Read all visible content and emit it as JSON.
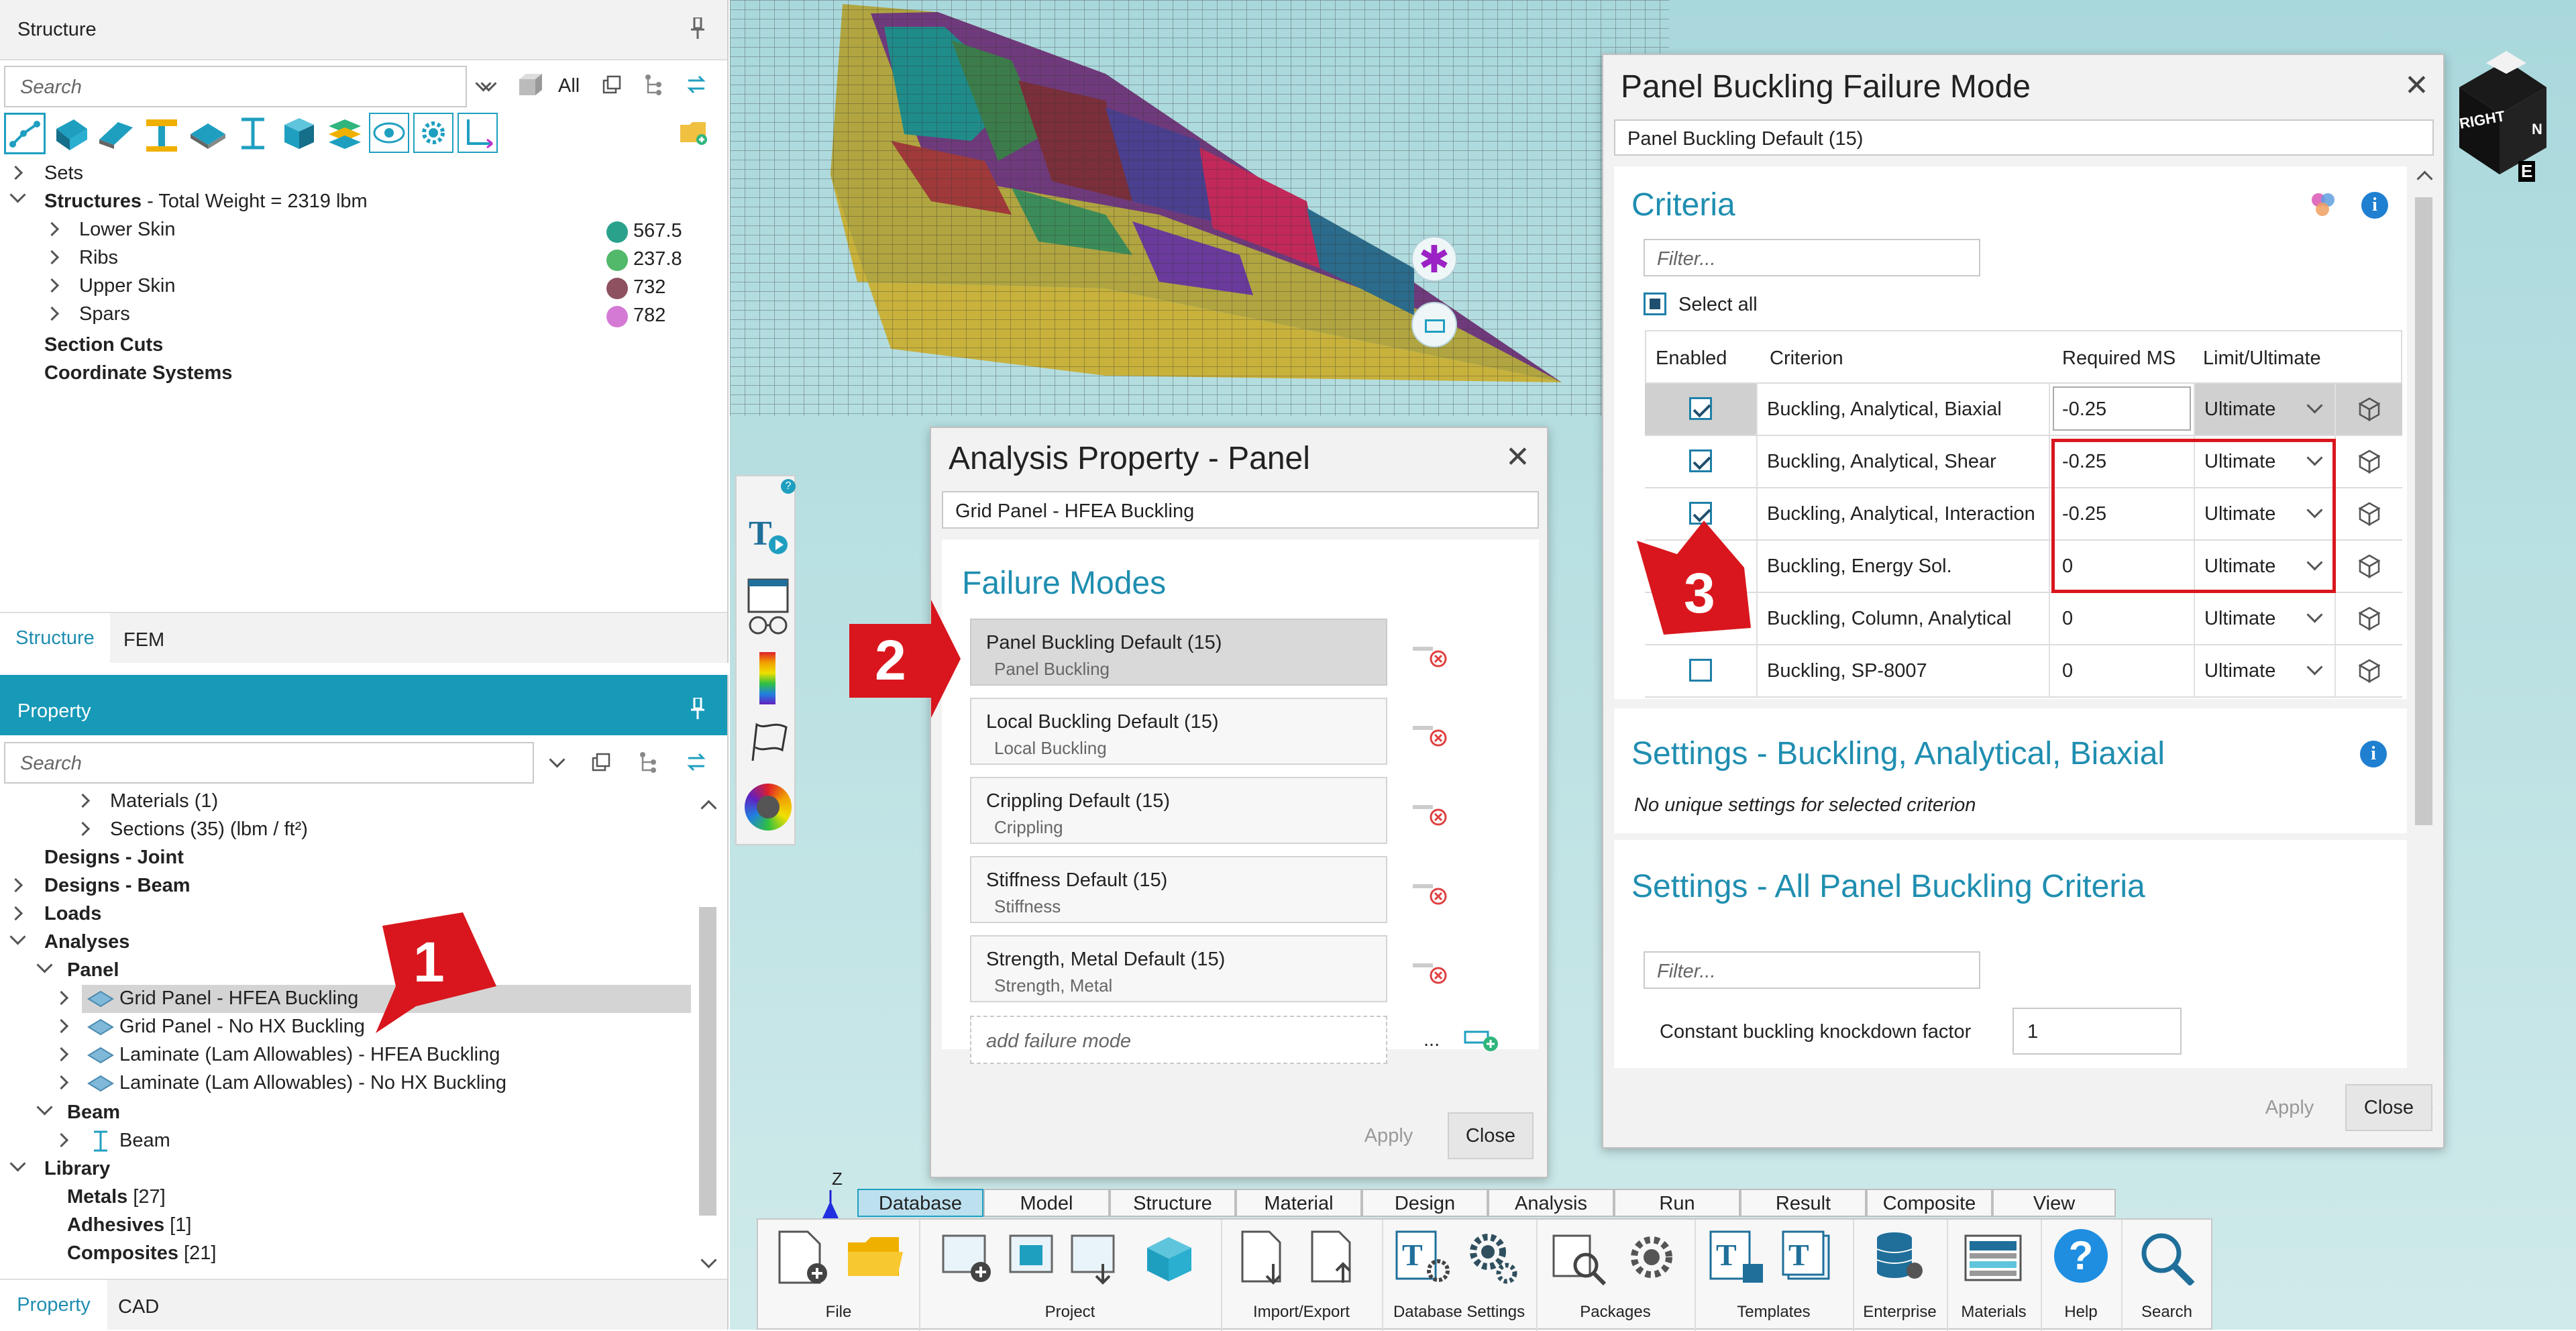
{
  "structure_panel": {
    "title": "Structure",
    "search_placeholder": "Search",
    "filter_label": "All",
    "tree": {
      "sets": "Sets",
      "structures_label": "Structures",
      "structures_weight": " - Total Weight = 2319 lbm",
      "children": [
        {
          "label": "Lower Skin",
          "value": "567.5",
          "color": "#2aa28b"
        },
        {
          "label": "Ribs",
          "value": "237.8",
          "color": "#52b86a"
        },
        {
          "label": "Upper Skin",
          "value": "732",
          "color": "#8e5160"
        },
        {
          "label": "Spars",
          "value": "782",
          "color": "#d47ad5"
        }
      ],
      "section_cuts": "Section Cuts",
      "coordinate_systems": "Coordinate Systems"
    },
    "tabs": [
      "Structure",
      "FEM"
    ]
  },
  "property_panel": {
    "title": "Property",
    "search_placeholder": "Search",
    "tree": {
      "materials": "Materials (1)",
      "sections": "Sections (35) (lbm / ft²)",
      "designs_joint": "Designs - Joint",
      "designs_beam": "Designs - Beam",
      "loads": "Loads",
      "analyses": "Analyses",
      "panel": "Panel",
      "panel_items": [
        "Grid Panel - HFEA Buckling",
        "Grid Panel - No HX Buckling",
        "Laminate (Lam Allowables) - HFEA Buckling",
        "Laminate (Lam Allowables) - No HX Buckling"
      ],
      "beam": "Beam",
      "beam_item": "Beam",
      "library": "Library",
      "library_items": [
        {
          "label": "Metals",
          "count": " [27]"
        },
        {
          "label": "Adhesives",
          "count": " [1]"
        },
        {
          "label": "Composites",
          "count": " [21]"
        }
      ]
    },
    "tabs": [
      "Property",
      "CAD"
    ]
  },
  "analysis_dialog": {
    "title": "Analysis Property - Panel",
    "name_value": "Grid Panel - HFEA Buckling",
    "section_title": "Failure Modes",
    "modes": [
      {
        "name": "Panel Buckling Default (15)",
        "type": "Panel Buckling"
      },
      {
        "name": "Local Buckling Default (15)",
        "type": "Local Buckling"
      },
      {
        "name": "Crippling Default (15)",
        "type": "Crippling"
      },
      {
        "name": "Stiffness Default (15)",
        "type": "Stiffness"
      },
      {
        "name": "Strength, Metal Default (15)",
        "type": "Strength, Metal"
      }
    ],
    "add_placeholder": "add failure mode",
    "ellipsis": "...",
    "apply": "Apply",
    "close": "Close"
  },
  "buckling_dialog": {
    "title": "Panel Buckling Failure Mode",
    "name_value": "Panel Buckling Default (15)",
    "criteria_title": "Criteria",
    "filter_placeholder": "Filter...",
    "select_all": "Select all",
    "columns": [
      "Enabled",
      "Criterion",
      "Required MS",
      "Limit/Ultimate"
    ],
    "rows": [
      {
        "enabled": true,
        "criterion": "Buckling, Analytical, Biaxial",
        "ms": "-0.25",
        "limit": "Ultimate"
      },
      {
        "enabled": true,
        "criterion": "Buckling, Analytical, Shear",
        "ms": "-0.25",
        "limit": "Ultimate"
      },
      {
        "enabled": true,
        "criterion": "Buckling, Analytical, Interaction",
        "ms": "-0.25",
        "limit": "Ultimate"
      },
      {
        "enabled": false,
        "criterion": "Buckling, Energy Sol.",
        "ms": "0",
        "limit": "Ultimate"
      },
      {
        "enabled": false,
        "criterion": "Buckling, Column, Analytical",
        "ms": "0",
        "limit": "Ultimate"
      },
      {
        "enabled": false,
        "criterion": "Buckling, SP-8007",
        "ms": "0",
        "limit": "Ultimate"
      }
    ],
    "settings_title": "Settings - Buckling, Analytical, Biaxial",
    "settings_note": "No unique settings for selected criterion",
    "settings_all_title": "Settings - All Panel Buckling Criteria",
    "filter2_placeholder": "Filter...",
    "knockdown_label": "Constant buckling knockdown factor",
    "knockdown_value": "1",
    "apply": "Apply",
    "close": "Close"
  },
  "viewcube": {
    "face": "RIGHT",
    "edge": "N",
    "bottom": "E"
  },
  "axis_label": "Z",
  "callouts": [
    "1",
    "2",
    "3"
  ],
  "ribbon": {
    "tabs": [
      "Database",
      "Model",
      "Structure",
      "Material",
      "Design",
      "Analysis",
      "Run",
      "Result",
      "Composite",
      "View"
    ],
    "groups": [
      "File",
      "Project",
      "Import/Export",
      "Database Settings",
      "Packages",
      "Templates",
      "Enterprise",
      "Materials",
      "Help",
      "Search"
    ]
  },
  "colors": {
    "accent": "#1799b8",
    "callout_red": "#d9161d",
    "viewport_bg": "#bfe3e3"
  }
}
